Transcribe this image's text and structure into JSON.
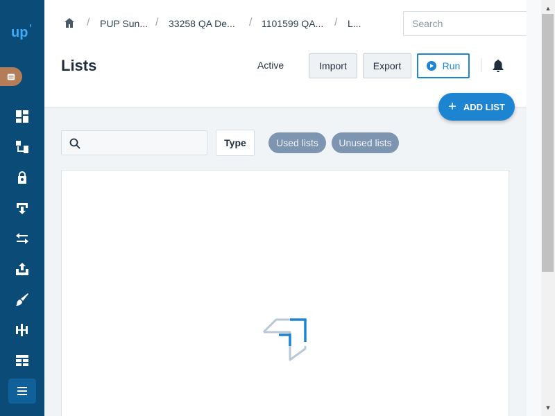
{
  "app": {
    "logo_text": "up"
  },
  "sidebar": {
    "items": [
      {
        "name": "dashboard",
        "icon": "dashboard-icon"
      },
      {
        "name": "hierarchy",
        "icon": "hierarchy-icon"
      },
      {
        "name": "security",
        "icon": "lock-icon"
      },
      {
        "name": "download",
        "icon": "download-icon"
      },
      {
        "name": "transfer",
        "icon": "swap-icon"
      },
      {
        "name": "upload",
        "icon": "upload-icon"
      },
      {
        "name": "customize",
        "icon": "brush-icon"
      },
      {
        "name": "flows",
        "icon": "flow-icon"
      },
      {
        "name": "tables",
        "icon": "table-icon"
      },
      {
        "name": "lists",
        "icon": "list-icon",
        "active": true
      }
    ]
  },
  "breadcrumb": {
    "items": [
      "PUP Sun...",
      "33258 QA De...",
      "1101599 QA...",
      "L..."
    ],
    "separator": "/"
  },
  "search": {
    "placeholder": "Search"
  },
  "page": {
    "title": "Lists",
    "status": "Active",
    "import_label": "Import",
    "export_label": "Export",
    "run_label": "Run",
    "add_list_label": "ADD LIST",
    "add_list_icon": "plus-icon"
  },
  "filters": {
    "search_value": "",
    "type_label": "Type",
    "chips": [
      "Used lists",
      "Unused lists"
    ]
  },
  "colors": {
    "sidebar": "#0b4b78",
    "accent": "#1c84d1",
    "chip": "#7d95b0",
    "org_badge": "#b47c57"
  }
}
